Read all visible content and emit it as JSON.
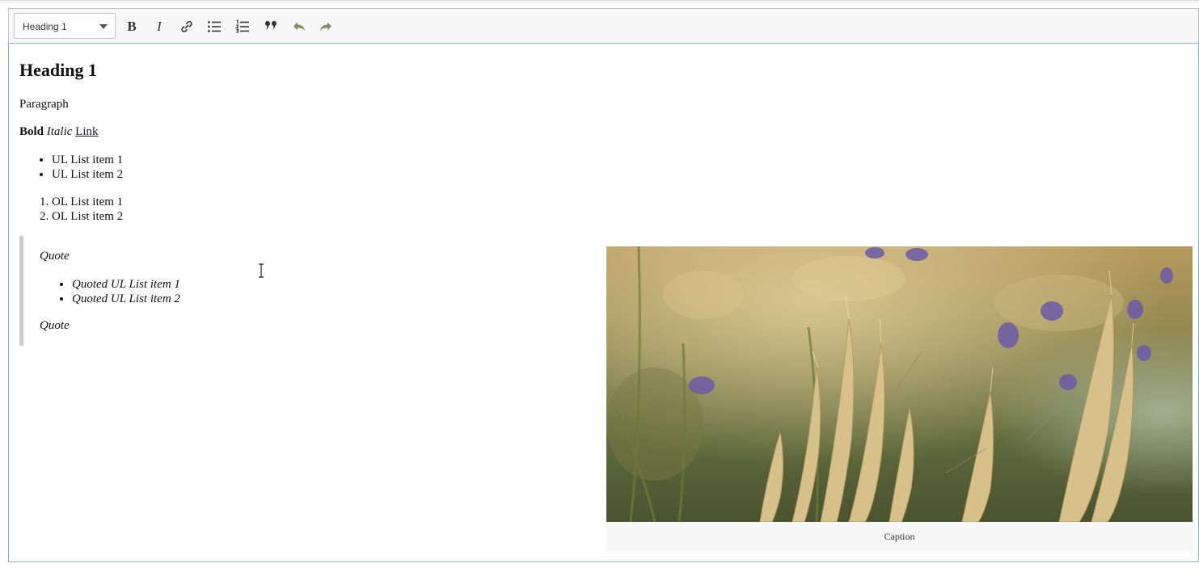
{
  "toolbar": {
    "heading_select": {
      "selected": "Heading 1"
    },
    "buttons": {
      "bold": "bold-icon",
      "italic": "italic-icon",
      "link": "link-icon",
      "bulleted_list": "bulleted-list-icon",
      "numbered_list": "numbered-list-icon",
      "block_quote": "quote-icon",
      "undo": "undo-icon",
      "redo": "redo-icon"
    },
    "bold_glyph": "B",
    "italic_glyph": "I"
  },
  "content": {
    "heading": "Heading 1",
    "paragraph": "Paragraph",
    "bold_text": "Bold",
    "italic_text": "Italic",
    "link_text": "Link",
    "ul_items": [
      "UL List item 1",
      "UL List item 2"
    ],
    "ol_items": [
      "OL List item 1",
      "OL List item 2"
    ],
    "quote": {
      "first": "Quote",
      "items": [
        "Quoted UL List item 1",
        "Quoted UL List item 2"
      ],
      "last": "Quote"
    },
    "image": {
      "description": "wheat-field-photo",
      "caption": "Caption"
    }
  },
  "colors": {
    "toolbar_bg": "#f7f7f7",
    "focus_border": "#7db4d8",
    "quote_border": "#cccccc",
    "icon": "#333333",
    "disabled_icon": "#8a8a6a"
  }
}
